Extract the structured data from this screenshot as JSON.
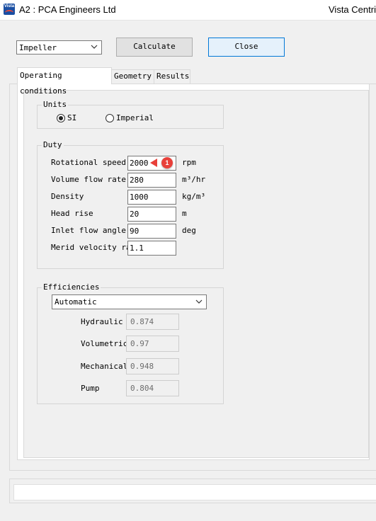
{
  "window": {
    "title": "A2 : PCA Engineers Ltd",
    "title_right": "Vista Centri",
    "app_icon_text": "Vista"
  },
  "toolbar": {
    "component_select": "Impeller",
    "calculate_label": "Calculate",
    "close_label": "Close"
  },
  "tabs": [
    {
      "label": "Operating conditions",
      "active": true
    },
    {
      "label": "Geometry",
      "active": false
    },
    {
      "label": "Results",
      "active": false
    }
  ],
  "units": {
    "title": "Units",
    "options": [
      {
        "label": "SI",
        "selected": true
      },
      {
        "label": "Imperial",
        "selected": false
      }
    ]
  },
  "duty": {
    "title": "Duty",
    "rows": [
      {
        "label": "Rotational speed",
        "value": "2000",
        "unit": "rpm"
      },
      {
        "label": "Volume flow rate",
        "value": "280",
        "unit": "m³/hr"
      },
      {
        "label": "Density",
        "value": "1000",
        "unit": "kg/m³"
      },
      {
        "label": "Head rise",
        "value": "20",
        "unit": "m"
      },
      {
        "label": "Inlet flow angle",
        "value": "90",
        "unit": "deg"
      },
      {
        "label": "Merid velocity rat",
        "value": "1.1",
        "unit": ""
      }
    ],
    "annotation_badge": "1"
  },
  "efficiencies": {
    "title": "Efficiencies",
    "mode_select": "Automatic",
    "rows": [
      {
        "label": "Hydraulic",
        "value": "0.874"
      },
      {
        "label": "Volumetric",
        "value": "0.97"
      },
      {
        "label": "Mechanical",
        "value": "0.948"
      },
      {
        "label": "Pump",
        "value": "0.804"
      }
    ]
  },
  "status_bar": {
    "text": ""
  }
}
